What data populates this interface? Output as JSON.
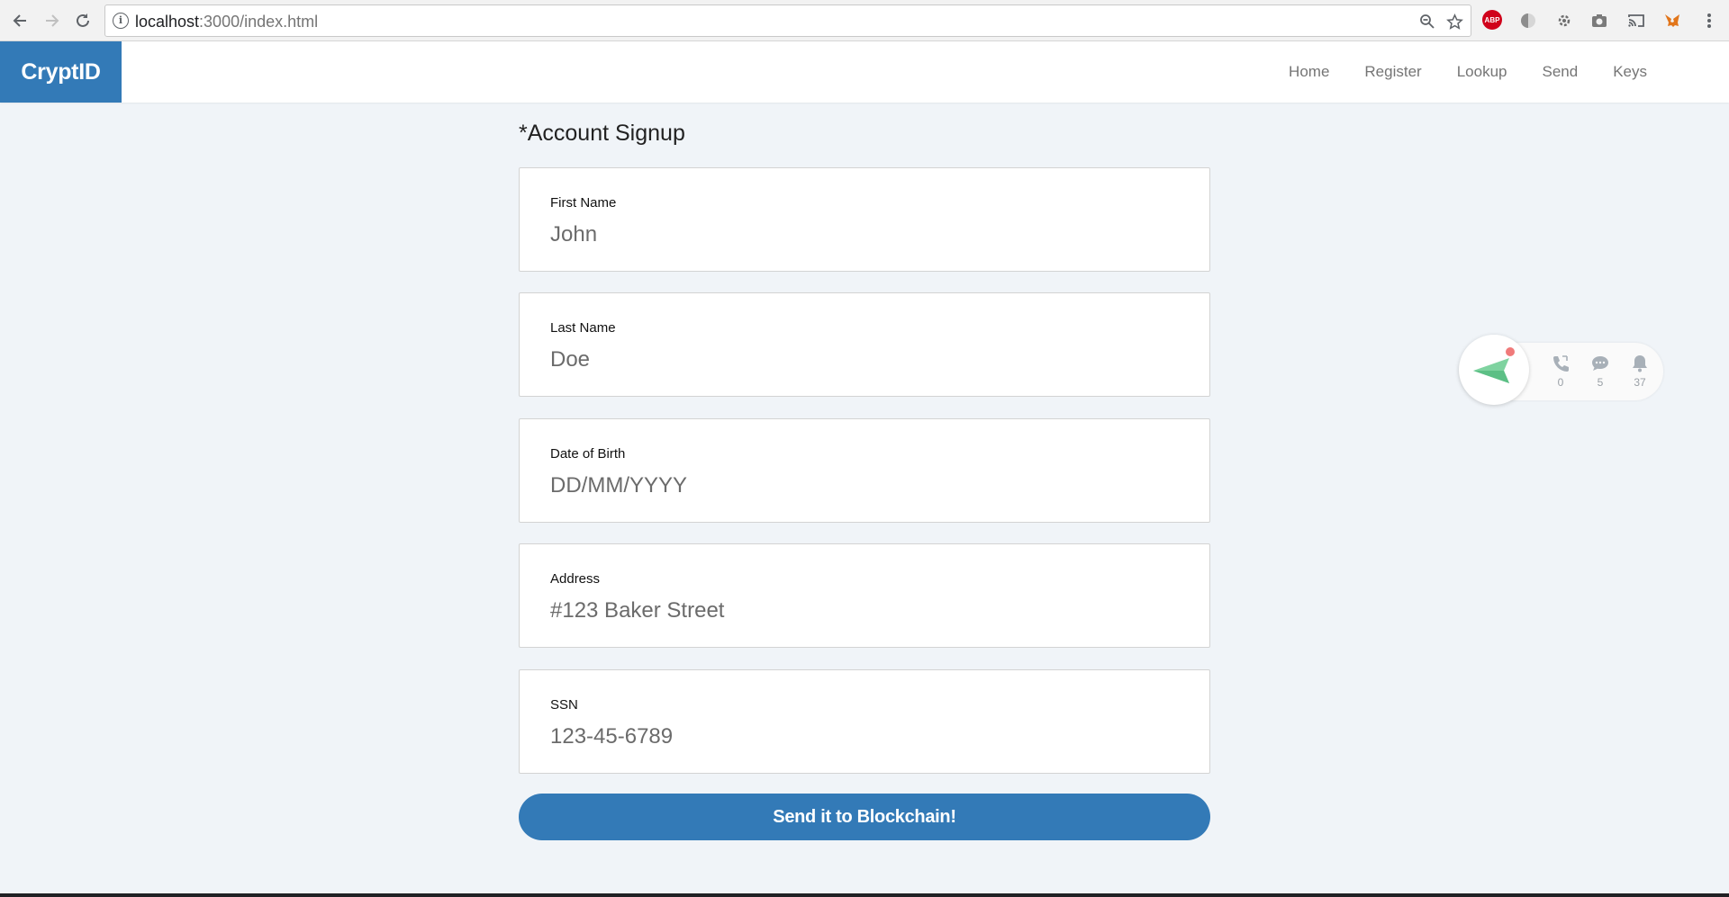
{
  "browser": {
    "url_host": "localhost",
    "url_path": ":3000/index.html",
    "info_icon": "i"
  },
  "app": {
    "brand": "CryptID",
    "nav": [
      "Home",
      "Register",
      "Lookup",
      "Send",
      "Keys"
    ]
  },
  "form": {
    "title": "*Account Signup",
    "fields": [
      {
        "label": "First Name",
        "placeholder": "John"
      },
      {
        "label": "Last Name",
        "placeholder": "Doe"
      },
      {
        "label": "Date of Birth",
        "placeholder": "DD/MM/YYYY"
      },
      {
        "label": "Address",
        "placeholder": "#123 Baker Street"
      },
      {
        "label": "SSN",
        "placeholder": "123-45-6789"
      }
    ],
    "submit_label": "Send it to Blockchain!"
  },
  "widget": {
    "calls": "0",
    "messages": "5",
    "notifications": "37",
    "icons": [
      "send-arrow-icon",
      "phone-icon",
      "chat-icon",
      "bell-icon"
    ]
  },
  "colors": {
    "brand": "#337ab7",
    "page_background": "#f0f4f8"
  }
}
